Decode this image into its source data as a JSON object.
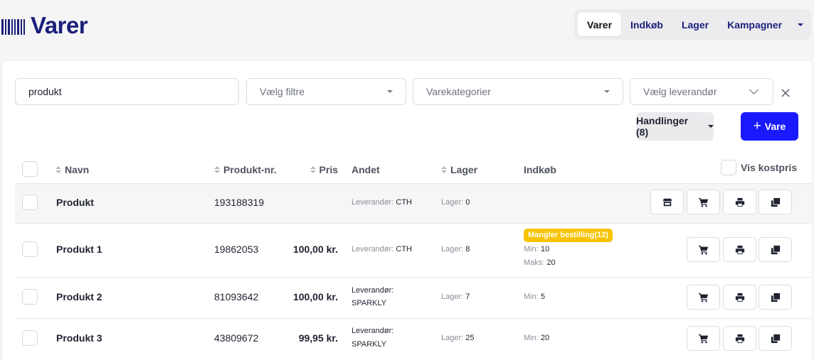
{
  "app": {
    "title": "Varer"
  },
  "nav": {
    "tabs": [
      {
        "label": "Varer",
        "active": true
      },
      {
        "label": "Indkøb",
        "active": false
      },
      {
        "label": "Lager",
        "active": false
      },
      {
        "label": "Kampagner",
        "active": false
      }
    ]
  },
  "filters": {
    "search_value": "produkt",
    "filter_placeholder": "Vælg filtre",
    "category_placeholder": "Varekategorier",
    "supplier_placeholder": "Vælg leverandør"
  },
  "toolbar": {
    "actions_label": "Handlinger (8)",
    "add_label": "Vare",
    "add_icon": "plus-icon",
    "add_color": "#1a1aff"
  },
  "table": {
    "columns": {
      "name": "Navn",
      "product_no": "Produkt-nr.",
      "price": "Pris",
      "other": "Andet",
      "stock": "Lager",
      "purchase": "Indkøb",
      "show_cost": "Vis kostpris"
    },
    "supplier_key": "Leverandør:",
    "stock_key": "Lager:",
    "min_key": "Min:",
    "max_key": "Maks:",
    "rows": [
      {
        "name": "Produkt",
        "product_no": "193188319",
        "price": "",
        "supplier": "CTH",
        "stock": "0",
        "badge": "",
        "min": "",
        "max": ""
      },
      {
        "name": "Produkt 1",
        "product_no": "19862053",
        "price": "100,00 kr.",
        "supplier": "CTH",
        "stock": "8",
        "badge": "Mangler bestilling(12)",
        "min": "10",
        "max": "20"
      },
      {
        "name": "Produkt 2",
        "product_no": "81093642",
        "price": "100,00 kr.",
        "supplier": "SPARKLY",
        "stock": "7",
        "badge": "",
        "min": "5",
        "max": ""
      },
      {
        "name": "Produkt 3",
        "product_no": "43809672",
        "price": "99,95 kr.",
        "supplier": "SPARKLY",
        "stock": "25",
        "badge": "",
        "min": "20",
        "max": ""
      }
    ]
  },
  "colors": {
    "brand": "#1b1f7a",
    "badge": "#f7c400"
  }
}
